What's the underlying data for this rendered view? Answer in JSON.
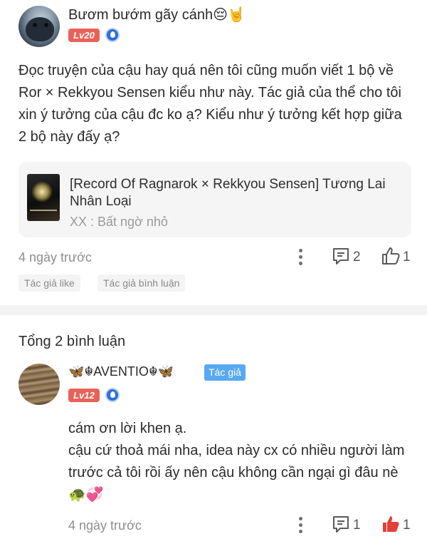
{
  "post": {
    "author_name": "Bươm bướm gãy cánh😔🤘",
    "level_badge": "Lv20",
    "comment": "Đọc truyện của cậu hay quá nên tôi cũng muốn viết 1 bộ về Ror × Rekkyou Sensen kiểu như này. Tác giả của thể cho tôi xin ý tưởng của cậu đc ko ạ? Kiểu như ý tưởng kết hợp giữa 2 bộ này đấy ạ?",
    "linked_story": {
      "title": "[Record Of Ragnarok × Rekkyou Sensen] Tương Lai Nhân Loại",
      "subtitle": "XX : Bất ngờ nhỏ"
    },
    "time": "4 ngày trước",
    "comment_count": "2",
    "like_count": "1",
    "tags": [
      "Tác giả like",
      "Tác giả bình luận"
    ]
  },
  "replies_header": "Tổng 2 bình luận",
  "reply": {
    "author_name": "🦋☬AVENTIO☬🦋",
    "author_badge": "Tác giả",
    "level_badge": "Lv12",
    "text_line1": "cám ơn lời khen ạ.",
    "text_line2": "cậu cứ thoả mái nha, idea này cx có nhiều người làm trước cả tôi rồi ấy nên cậu không cần ngại gì đâu nè 🐢💞",
    "time": "4 ngày trước",
    "comment_count": "1",
    "like_count": "1"
  },
  "colors": {
    "level_badge": "#e96258",
    "author_badge": "#57a9f2",
    "liked": "#e53f3a",
    "muted": "#8e8e8e"
  },
  "icons": [
    "more-vertical-icon",
    "comment-icon",
    "thumbs-up-outline-icon",
    "thumbs-up-filled-icon",
    "water-drop-badge-icon"
  ]
}
